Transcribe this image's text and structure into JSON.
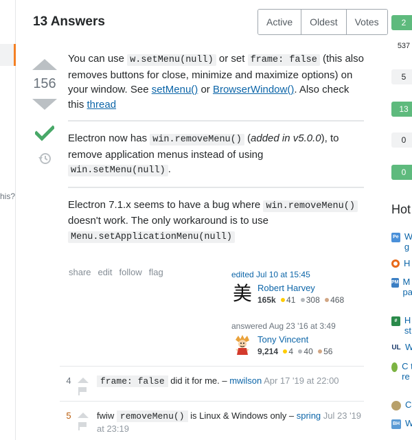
{
  "left_sidebar": {
    "cut_text": "his?"
  },
  "answers": {
    "title": "13 Answers",
    "sort_tabs": [
      "Active",
      "Oldest",
      "Votes"
    ]
  },
  "post": {
    "votes": "156",
    "p1": {
      "t1": "You can use ",
      "c1": "w.setMenu(null)",
      "t2": " or set ",
      "c2": "frame: false",
      "t3": " (this also removes buttons for close, minimize and maximize options) on your window. See ",
      "l1": "setMenu()",
      "t4": " or ",
      "l2": "BrowserWindow()",
      "t5": ". Also check this ",
      "l3": "thread"
    },
    "p2": {
      "t1": "Electron now has ",
      "c1": "win.removeMenu()",
      "t2": " (",
      "em": "added in v5.0.0",
      "t3": "), to remove application menus instead of using ",
      "c2": "win.setMenu(null)",
      "t4": "."
    },
    "p3": {
      "t1": "Electron 7.1.x seems to have a bug where ",
      "c1": "win.removeMenu()",
      "t2": " doesn't work. The only workaround is to use ",
      "c2": "Menu.setApplicationMenu(null)"
    },
    "menu": [
      "share",
      "edit",
      "follow",
      "flag"
    ],
    "edited": {
      "action": "edited Jul 10 at 15:45",
      "name": "Robert Harvey",
      "rep": "165k",
      "gold": "41",
      "silver": "308",
      "bronze": "468",
      "avatar_glyph": "美"
    },
    "answered": {
      "action": "answered Aug 23 '16 at 3:49",
      "name": "Tony Vincent",
      "rep": "9,214",
      "gold": "4",
      "silver": "40",
      "bronze": "56"
    }
  },
  "comments": [
    {
      "score": "4",
      "code": "frame: false",
      "text": " did it for me. – ",
      "user": "mwilson",
      "date": " Apr 17 '19 at 22:00"
    },
    {
      "score": "5",
      "pre": "fwiw ",
      "code": "removeMenu()",
      "text": " is Linux & Windows only – ",
      "user": "spring",
      "date": " Jul 23 '19 at 23:19"
    }
  ],
  "right_sidebar": {
    "counts": [
      "2",
      "537",
      "5",
      "13",
      "0",
      "0"
    ],
    "hot_title": "Hot",
    "hot_items": [
      "W g",
      "H",
      "M n pa",
      "H st",
      "W",
      "C tc re",
      "C",
      "W"
    ]
  },
  "colors": {
    "accent_orange": "#f48024",
    "accepted_green": "#48a868",
    "link_blue": "#0c65a8",
    "answer_green": "#5eba7d"
  }
}
